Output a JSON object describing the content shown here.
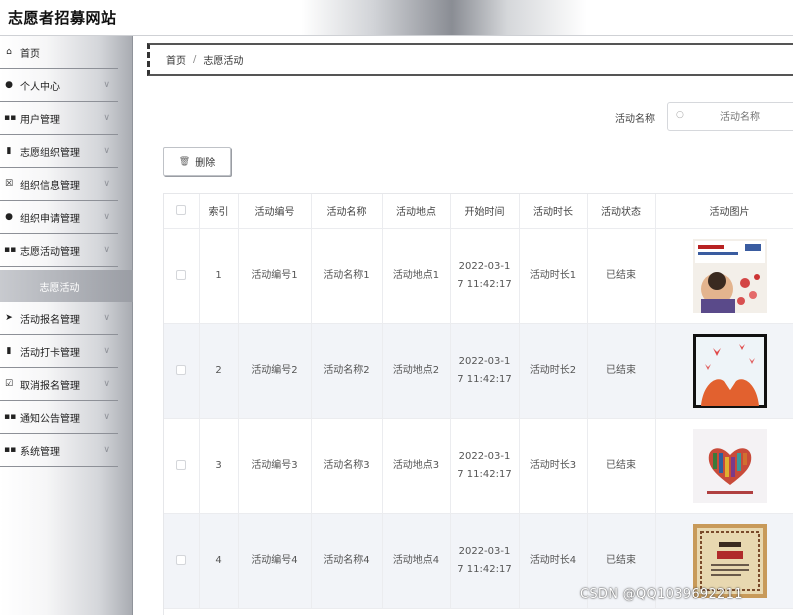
{
  "header": {
    "site_title": "志愿者招募网站"
  },
  "sidebar": {
    "items": [
      {
        "label": "首页",
        "icon": "home-icon",
        "glyph": "⌂",
        "expandable": false
      },
      {
        "label": "个人中心",
        "icon": "user-icon",
        "glyph": "👤",
        "expandable": true
      },
      {
        "label": "用户管理",
        "icon": "grid-icon",
        "glyph": "▪▪",
        "expandable": true
      },
      {
        "label": "志愿组织管理",
        "icon": "chart-icon",
        "glyph": "▮",
        "expandable": true
      },
      {
        "label": "组织信息管理",
        "icon": "info-box-icon",
        "glyph": "☒",
        "expandable": true
      },
      {
        "label": "组织申请管理",
        "icon": "person-icon",
        "glyph": "⚲",
        "expandable": true
      },
      {
        "label": "志愿活动管理",
        "icon": "grid-icon",
        "glyph": "▪▪",
        "expandable": true
      },
      {
        "label": "活动报名管理",
        "icon": "send-icon",
        "glyph": "➤",
        "expandable": true
      },
      {
        "label": "活动打卡管理",
        "icon": "bar-chart-icon",
        "glyph": "▮",
        "expandable": true
      },
      {
        "label": "取消报名管理",
        "icon": "checkbox-icon",
        "glyph": "☑",
        "expandable": true
      },
      {
        "label": "通知公告管理",
        "icon": "grid-icon",
        "glyph": "▪▪",
        "expandable": true
      },
      {
        "label": "系统管理",
        "icon": "grid-icon",
        "glyph": "▪▪",
        "expandable": true
      }
    ],
    "active_sub": "志愿活动"
  },
  "breadcrumb": {
    "home": "首页",
    "separator": "/",
    "current": "志愿活动"
  },
  "search": {
    "label": "活动名称",
    "placeholder": "活动名称",
    "value": ""
  },
  "toolbar": {
    "delete_label": "删除"
  },
  "table": {
    "columns": [
      "",
      "索引",
      "活动编号",
      "活动名称",
      "活动地点",
      "开始时间",
      "活动时长",
      "活动状态",
      "活动图片"
    ],
    "rows": [
      {
        "index": "1",
        "code": "活动编号1",
        "name": "活动名称1",
        "place": "活动地点1",
        "start_1": "2022-03-1",
        "start_2": "7 11:42:17",
        "duration": "活动时长1",
        "status": "已结束"
      },
      {
        "index": "2",
        "code": "活动编号2",
        "name": "活动名称2",
        "place": "活动地点2",
        "start_1": "2022-03-1",
        "start_2": "7 11:42:17",
        "duration": "活动时长2",
        "status": "已结束"
      },
      {
        "index": "3",
        "code": "活动编号3",
        "name": "活动名称3",
        "place": "活动地点3",
        "start_1": "2022-03-1",
        "start_2": "7 11:42:17",
        "duration": "活动时长3",
        "status": "已结束"
      },
      {
        "index": "4",
        "code": "活动编号4",
        "name": "活动名称4",
        "place": "活动地点4",
        "start_1": "2022-03-1",
        "start_2": "7 11:42:17",
        "duration": "活动时长4",
        "status": "已结束"
      }
    ]
  },
  "watermark": "CSDN @QQ1039692211"
}
